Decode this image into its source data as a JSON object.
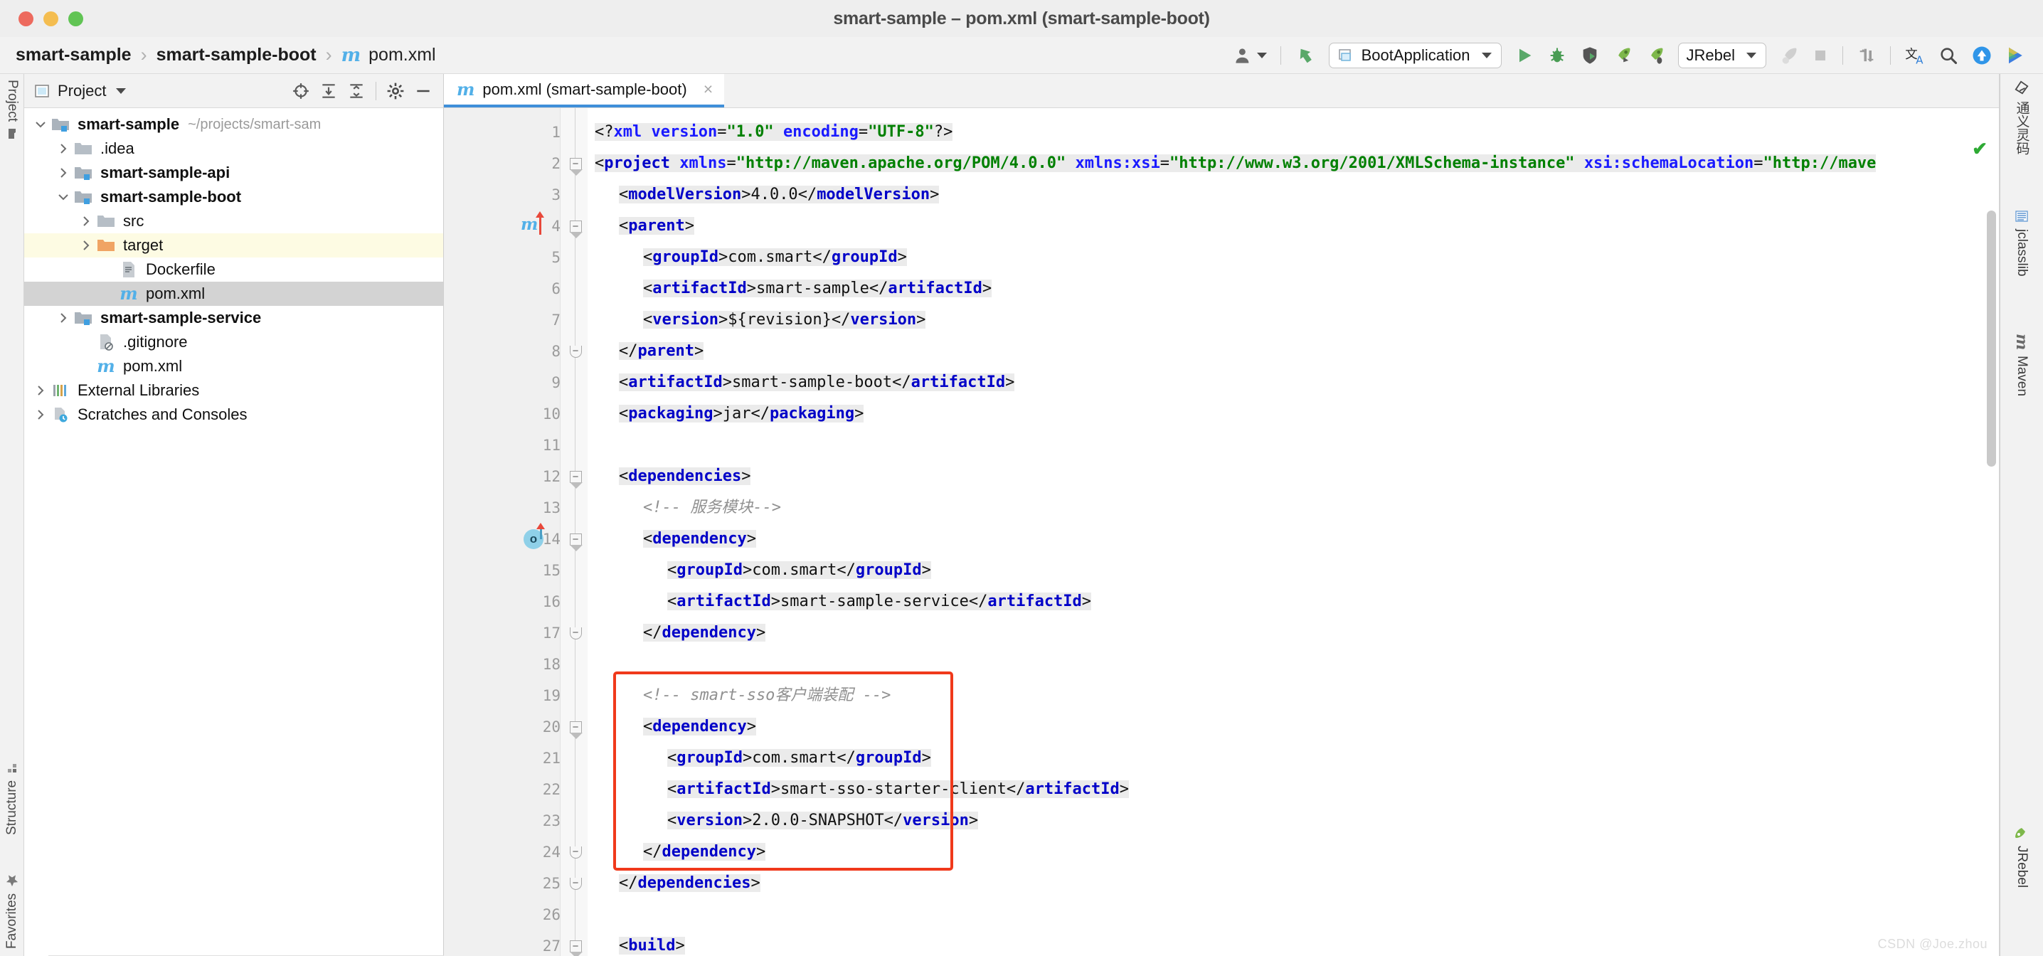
{
  "window": {
    "title": "smart-sample – pom.xml (smart-sample-boot)",
    "traffic_lights": [
      "close",
      "minimize",
      "zoom"
    ]
  },
  "breadcrumb": {
    "items": [
      {
        "label": "smart-sample",
        "bold": true,
        "icon": null
      },
      {
        "label": "smart-sample-boot",
        "bold": true,
        "icon": null
      },
      {
        "label": "pom.xml",
        "bold": false,
        "icon": "maven-m-icon"
      }
    ],
    "separator": "›"
  },
  "toolbar": {
    "account_label": "",
    "run_config": "BootApplication",
    "jrebel_config": "JRebel",
    "buttons": [
      {
        "name": "user-account-dropdown",
        "icon": "user-icon"
      },
      {
        "name": "update-project-button",
        "icon": "vcs-update-icon"
      },
      {
        "name": "run-configuration-selector",
        "icon": "run-config-icon"
      },
      {
        "name": "run-button",
        "icon": "play-icon"
      },
      {
        "name": "debug-button",
        "icon": "bug-icon"
      },
      {
        "name": "run-with-coverage-button",
        "icon": "coverage-icon"
      },
      {
        "name": "jrebel-run-button",
        "icon": "rocket-icon"
      },
      {
        "name": "jrebel-debug-button",
        "icon": "rocket-bug-icon"
      },
      {
        "name": "jrebel-config-selector",
        "icon": "jrebel-icon"
      },
      {
        "name": "jrebel-run-disabled-button",
        "icon": "rocket-grey-icon"
      },
      {
        "name": "stop-button",
        "icon": "stop-square-icon"
      },
      {
        "name": "compare-button",
        "icon": "diff-icon"
      },
      {
        "name": "translate-button",
        "icon": "translate-icon"
      },
      {
        "name": "search-everywhere-button",
        "icon": "search-icon"
      },
      {
        "name": "upload-button",
        "icon": "upload-arrow-icon"
      },
      {
        "name": "tongyi-button",
        "icon": "tongyi-icon"
      }
    ]
  },
  "left_strip": {
    "project_label": "Project",
    "structure_label": "Structure",
    "favorites_label": "Favorites"
  },
  "project_panel": {
    "header_title": "Project",
    "header_icons": [
      {
        "name": "select-opened-file-icon",
        "glyph": "⊕"
      },
      {
        "name": "expand-all-icon",
        "glyph": "↧"
      },
      {
        "name": "collapse-all-icon",
        "glyph": "↥"
      },
      {
        "name": "settings-gear-icon",
        "glyph": "⚙"
      },
      {
        "name": "hide-panel-icon",
        "glyph": "—"
      }
    ],
    "tree": [
      {
        "label": "smart-sample",
        "path": "~/projects/smart-sam",
        "indent": 0,
        "twist": "open",
        "icon": "module-folder-icon",
        "bold": true,
        "state": "normal"
      },
      {
        "label": ".idea",
        "path": "",
        "indent": 1,
        "twist": "closed",
        "icon": "folder-icon",
        "bold": false,
        "state": "normal"
      },
      {
        "label": "smart-sample-api",
        "path": "",
        "indent": 1,
        "twist": "closed",
        "icon": "module-folder-icon",
        "bold": true,
        "state": "normal"
      },
      {
        "label": "smart-sample-boot",
        "path": "",
        "indent": 1,
        "twist": "open",
        "icon": "module-folder-icon",
        "bold": true,
        "state": "normal"
      },
      {
        "label": "src",
        "path": "",
        "indent": 2,
        "twist": "closed",
        "icon": "folder-icon",
        "bold": false,
        "state": "normal"
      },
      {
        "label": "target",
        "path": "",
        "indent": 2,
        "twist": "closed",
        "icon": "excluded-folder-icon",
        "bold": false,
        "state": "highlight"
      },
      {
        "label": "Dockerfile",
        "path": "",
        "indent": 3,
        "twist": "none",
        "icon": "docker-file-icon",
        "bold": false,
        "state": "normal"
      },
      {
        "label": "pom.xml",
        "path": "",
        "indent": 3,
        "twist": "none",
        "icon": "maven-m-icon",
        "bold": false,
        "state": "selected"
      },
      {
        "label": "smart-sample-service",
        "path": "",
        "indent": 1,
        "twist": "closed",
        "icon": "module-folder-icon",
        "bold": true,
        "state": "normal"
      },
      {
        "label": ".gitignore",
        "path": "",
        "indent": 2,
        "twist": "none",
        "icon": "gitignore-file-icon",
        "bold": false,
        "state": "normal"
      },
      {
        "label": "pom.xml",
        "path": "",
        "indent": 2,
        "twist": "none",
        "icon": "maven-m-icon",
        "bold": false,
        "state": "normal"
      },
      {
        "label": "External Libraries",
        "path": "",
        "indent": 0,
        "twist": "closed",
        "icon": "libraries-icon",
        "bold": false,
        "state": "normal"
      },
      {
        "label": "Scratches and Consoles",
        "path": "",
        "indent": 0,
        "twist": "closed",
        "icon": "scratches-icon",
        "bold": false,
        "state": "normal"
      }
    ]
  },
  "editor": {
    "tab_label": "pom.xml (smart-sample-boot)",
    "tab_icon": "maven-m-icon",
    "tab_close": "×",
    "inspection_status": "✔",
    "gutter_markers": [
      {
        "line": 4,
        "type": "maven-update-marker",
        "glyph": "m"
      },
      {
        "line": 14,
        "type": "override-marker",
        "glyph": "o"
      }
    ],
    "lines": [
      {
        "n": 1,
        "fold": "none",
        "indent": 0,
        "tokens": [
          {
            "t": "tx",
            "v": "<?"
          },
          {
            "t": "at",
            "v": "xml version"
          },
          {
            "t": "tx",
            "v": "="
          },
          {
            "t": "st",
            "v": "\"1.0\""
          },
          {
            "t": "tx",
            "v": " "
          },
          {
            "t": "at",
            "v": "encoding"
          },
          {
            "t": "tx",
            "v": "="
          },
          {
            "t": "st",
            "v": "\"UTF-8\""
          },
          {
            "t": "tx",
            "v": "?>"
          }
        ]
      },
      {
        "n": 2,
        "fold": "open",
        "indent": 0,
        "tokens": [
          {
            "t": "tx",
            "v": "<"
          },
          {
            "t": "tg",
            "v": "project"
          },
          {
            "t": "tx",
            "v": " "
          },
          {
            "t": "at",
            "v": "xmlns"
          },
          {
            "t": "tx",
            "v": "="
          },
          {
            "t": "st",
            "v": "\"http://maven.apache.org/POM/4.0.0\""
          },
          {
            "t": "tx",
            "v": " "
          },
          {
            "t": "at",
            "v": "xmlns:xsi"
          },
          {
            "t": "tx",
            "v": "="
          },
          {
            "t": "st",
            "v": "\"http://www.w3.org/2001/XMLSchema-instance\""
          },
          {
            "t": "tx",
            "v": " "
          },
          {
            "t": "at",
            "v": "xsi:schemaLocation"
          },
          {
            "t": "tx",
            "v": "="
          },
          {
            "t": "st",
            "v": "\"http://mave"
          }
        ]
      },
      {
        "n": 3,
        "fold": "none",
        "indent": 1,
        "tokens": [
          {
            "t": "tx",
            "v": "<"
          },
          {
            "t": "tg",
            "v": "modelVersion"
          },
          {
            "t": "tx",
            "v": ">"
          },
          {
            "t": "tx",
            "v": "4.0.0"
          },
          {
            "t": "tx",
            "v": "</"
          },
          {
            "t": "tg",
            "v": "modelVersion"
          },
          {
            "t": "tx",
            "v": ">"
          }
        ]
      },
      {
        "n": 4,
        "fold": "open",
        "indent": 1,
        "tokens": [
          {
            "t": "tx",
            "v": "<"
          },
          {
            "t": "tg",
            "v": "parent"
          },
          {
            "t": "tx",
            "v": ">"
          }
        ]
      },
      {
        "n": 5,
        "fold": "none",
        "indent": 2,
        "tokens": [
          {
            "t": "tx",
            "v": "<"
          },
          {
            "t": "tg",
            "v": "groupId"
          },
          {
            "t": "tx",
            "v": ">com.smart</"
          },
          {
            "t": "tg",
            "v": "groupId"
          },
          {
            "t": "tx",
            "v": ">"
          }
        ]
      },
      {
        "n": 6,
        "fold": "none",
        "indent": 2,
        "tokens": [
          {
            "t": "tx",
            "v": "<"
          },
          {
            "t": "tg",
            "v": "artifactId"
          },
          {
            "t": "tx",
            "v": ">smart-sample</"
          },
          {
            "t": "tg",
            "v": "artifactId"
          },
          {
            "t": "tx",
            "v": ">"
          }
        ]
      },
      {
        "n": 7,
        "fold": "none",
        "indent": 2,
        "tokens": [
          {
            "t": "tx",
            "v": "<"
          },
          {
            "t": "tg",
            "v": "version"
          },
          {
            "t": "tx",
            "v": ">${revision}</"
          },
          {
            "t": "tg",
            "v": "version"
          },
          {
            "t": "tx",
            "v": ">"
          }
        ]
      },
      {
        "n": 8,
        "fold": "close",
        "indent": 1,
        "tokens": [
          {
            "t": "tx",
            "v": "</"
          },
          {
            "t": "tg",
            "v": "parent"
          },
          {
            "t": "tx",
            "v": ">"
          }
        ]
      },
      {
        "n": 9,
        "fold": "none",
        "indent": 1,
        "tokens": [
          {
            "t": "tx",
            "v": "<"
          },
          {
            "t": "tg",
            "v": "artifactId"
          },
          {
            "t": "tx",
            "v": ">smart-sample-boot</"
          },
          {
            "t": "tg",
            "v": "artifactId"
          },
          {
            "t": "tx",
            "v": ">"
          }
        ]
      },
      {
        "n": 10,
        "fold": "none",
        "indent": 1,
        "tokens": [
          {
            "t": "tx",
            "v": "<"
          },
          {
            "t": "tg",
            "v": "packaging"
          },
          {
            "t": "tx",
            "v": ">jar</"
          },
          {
            "t": "tg",
            "v": "packaging"
          },
          {
            "t": "tx",
            "v": ">"
          }
        ]
      },
      {
        "n": 11,
        "fold": "none",
        "indent": 1,
        "tokens": []
      },
      {
        "n": 12,
        "fold": "open",
        "indent": 1,
        "tokens": [
          {
            "t": "tx",
            "v": "<"
          },
          {
            "t": "tg",
            "v": "dependencies"
          },
          {
            "t": "tx",
            "v": ">"
          }
        ]
      },
      {
        "n": 13,
        "fold": "none",
        "indent": 2,
        "tokens": [
          {
            "t": "cm",
            "v": "<!-- 服务模块-->"
          }
        ]
      },
      {
        "n": 14,
        "fold": "open",
        "indent": 2,
        "tokens": [
          {
            "t": "tx",
            "v": "<"
          },
          {
            "t": "tg",
            "v": "dependency"
          },
          {
            "t": "tx",
            "v": ">"
          }
        ]
      },
      {
        "n": 15,
        "fold": "none",
        "indent": 3,
        "tokens": [
          {
            "t": "tx",
            "v": "<"
          },
          {
            "t": "tg",
            "v": "groupId"
          },
          {
            "t": "tx",
            "v": ">com.smart</"
          },
          {
            "t": "tg",
            "v": "groupId"
          },
          {
            "t": "tx",
            "v": ">"
          }
        ]
      },
      {
        "n": 16,
        "fold": "none",
        "indent": 3,
        "tokens": [
          {
            "t": "tx",
            "v": "<"
          },
          {
            "t": "tg",
            "v": "artifactId"
          },
          {
            "t": "tx",
            "v": ">smart-sample-service</"
          },
          {
            "t": "tg",
            "v": "artifactId"
          },
          {
            "t": "tx",
            "v": ">"
          }
        ]
      },
      {
        "n": 17,
        "fold": "close",
        "indent": 2,
        "tokens": [
          {
            "t": "tx",
            "v": "</"
          },
          {
            "t": "tg",
            "v": "dependency"
          },
          {
            "t": "tx",
            "v": ">"
          }
        ]
      },
      {
        "n": 18,
        "fold": "none",
        "indent": 2,
        "tokens": []
      },
      {
        "n": 19,
        "fold": "none",
        "indent": 2,
        "tokens": [
          {
            "t": "cm",
            "v": "<!-- smart-sso客户端装配 -->"
          }
        ]
      },
      {
        "n": 20,
        "fold": "open",
        "indent": 2,
        "tokens": [
          {
            "t": "tx",
            "v": "<"
          },
          {
            "t": "tg",
            "v": "dependency"
          },
          {
            "t": "tx",
            "v": ">"
          }
        ]
      },
      {
        "n": 21,
        "fold": "none",
        "indent": 3,
        "tokens": [
          {
            "t": "tx",
            "v": "<"
          },
          {
            "t": "tg",
            "v": "groupId"
          },
          {
            "t": "tx",
            "v": ">com.smart</"
          },
          {
            "t": "tg",
            "v": "groupId"
          },
          {
            "t": "tx",
            "v": ">"
          }
        ]
      },
      {
        "n": 22,
        "fold": "none",
        "indent": 3,
        "tokens": [
          {
            "t": "tx",
            "v": "<"
          },
          {
            "t": "tg",
            "v": "artifactId"
          },
          {
            "t": "tx",
            "v": ">smart-sso-starter-client</"
          },
          {
            "t": "tg",
            "v": "artifactId"
          },
          {
            "t": "tx",
            "v": ">"
          }
        ]
      },
      {
        "n": 23,
        "fold": "none",
        "indent": 3,
        "tokens": [
          {
            "t": "tx",
            "v": "<"
          },
          {
            "t": "tg",
            "v": "version"
          },
          {
            "t": "tx",
            "v": ">2.0.0-SNAPSHOT</"
          },
          {
            "t": "tg",
            "v": "version"
          },
          {
            "t": "tx",
            "v": ">"
          }
        ]
      },
      {
        "n": 24,
        "fold": "close",
        "indent": 2,
        "tokens": [
          {
            "t": "tx",
            "v": "</"
          },
          {
            "t": "tg",
            "v": "dependency"
          },
          {
            "t": "tx",
            "v": ">"
          }
        ]
      },
      {
        "n": 25,
        "fold": "close",
        "indent": 1,
        "tokens": [
          {
            "t": "tx",
            "v": "</"
          },
          {
            "t": "tg",
            "v": "dependencies"
          },
          {
            "t": "tx",
            "v": ">"
          }
        ]
      },
      {
        "n": 26,
        "fold": "none",
        "indent": 0,
        "tokens": []
      },
      {
        "n": 27,
        "fold": "open",
        "indent": 1,
        "tokens": [
          {
            "t": "tx",
            "v": "<"
          },
          {
            "t": "tg",
            "v": "build"
          },
          {
            "t": "tx",
            "v": ">"
          }
        ]
      }
    ],
    "annotation_box": {
      "name": "sso-dependency-highlight",
      "color": "#f0391b",
      "covers_lines": [
        19,
        24
      ]
    }
  },
  "right_strip": {
    "items": [
      {
        "label": "通义灵码",
        "icon": "tongyi-lingma-icon"
      },
      {
        "label": "jclasslib",
        "icon": "jclasslib-icon"
      },
      {
        "label": "Maven",
        "icon": "maven-m-icon"
      },
      {
        "label": "JRebel",
        "icon": "jrebel-rocket-icon"
      }
    ]
  },
  "watermark": "CSDN @Joe.zhou",
  "colors": {
    "accent_blue": "#3f8fd9",
    "tag_blue": "#0000c8",
    "attr_blue": "#1a1aff",
    "string_green": "#008000",
    "comment_grey": "#909090",
    "annotation_red": "#f0391b",
    "maven_cyan": "#52b0e8"
  }
}
